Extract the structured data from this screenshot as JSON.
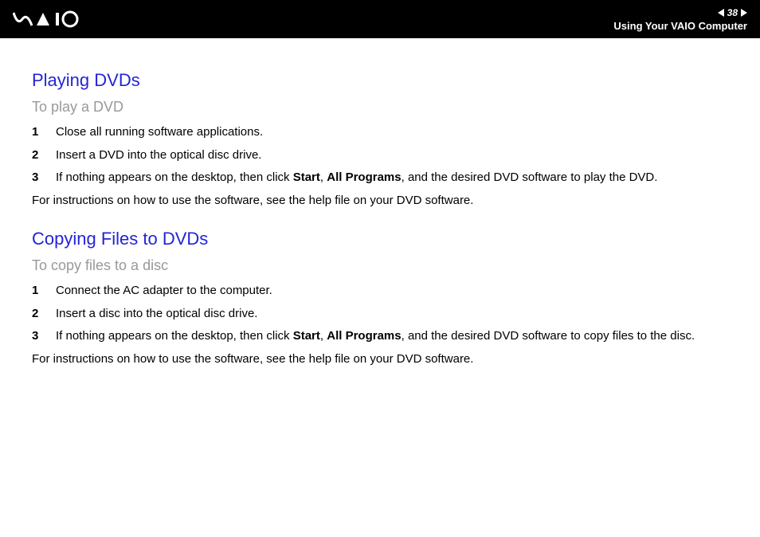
{
  "header": {
    "pageNumber": "38",
    "sectionTitle": "Using Your VAIO Computer"
  },
  "section1": {
    "title": "Playing DVDs",
    "subtitle": "To play a DVD",
    "steps": [
      {
        "num": "1",
        "text": "Close all running software applications."
      },
      {
        "num": "2",
        "text": "Insert a DVD into the optical disc drive."
      },
      {
        "num": "3",
        "prefix": "If nothing appears on the desktop, then click ",
        "bold1": "Start",
        "mid": ", ",
        "bold2": "All Programs",
        "suffix": ", and the desired DVD software to play the DVD."
      }
    ],
    "note": "For instructions on how to use the software, see the help file on your DVD software."
  },
  "section2": {
    "title": "Copying Files to DVDs",
    "subtitle": "To copy files to a disc",
    "steps": [
      {
        "num": "1",
        "text": "Connect the AC adapter to the computer."
      },
      {
        "num": "2",
        "text": "Insert a disc into the optical disc drive."
      },
      {
        "num": "3",
        "prefix": "If nothing appears on the desktop, then click ",
        "bold1": "Start",
        "mid": ", ",
        "bold2": "All Programs",
        "suffix": ", and the desired DVD software to copy files to the disc."
      }
    ],
    "note": "For instructions on how to use the software, see the help file on your DVD software."
  }
}
